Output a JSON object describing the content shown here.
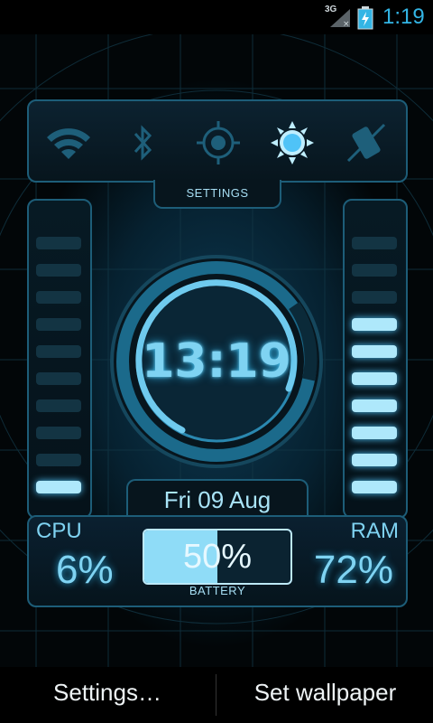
{
  "status_bar": {
    "network": "3G",
    "time": "1:19"
  },
  "widget": {
    "toggles": [
      {
        "icon": "wifi-icon",
        "state": "off"
      },
      {
        "icon": "bluetooth-icon",
        "state": "off"
      },
      {
        "icon": "gps-icon",
        "state": "off"
      },
      {
        "icon": "brightness-icon",
        "state": "on"
      },
      {
        "icon": "rotation-lock-icon",
        "state": "off"
      }
    ],
    "settings_label": "SETTINGS",
    "clock": "13:19",
    "date": "Fri 09 Aug",
    "cpu": {
      "label": "CPU",
      "value": "6%",
      "level": 0.06,
      "bars_on": 1,
      "bars_total": 10
    },
    "ram": {
      "label": "RAM",
      "value": "72%",
      "level": 0.72,
      "bars_on": 7,
      "bars_total": 10
    },
    "battery": {
      "label": "BATTERY",
      "value": "50%",
      "level": 0.5
    }
  },
  "colors": {
    "accent": "#7fd3f2",
    "panel_border": "#1d5d78",
    "bar_on": "#aee8fb",
    "bar_off": "#133443",
    "status_time": "#33b5e5"
  },
  "action_bar": {
    "settings_label": "Settings…",
    "wallpaper_label": "Set wallpaper"
  }
}
